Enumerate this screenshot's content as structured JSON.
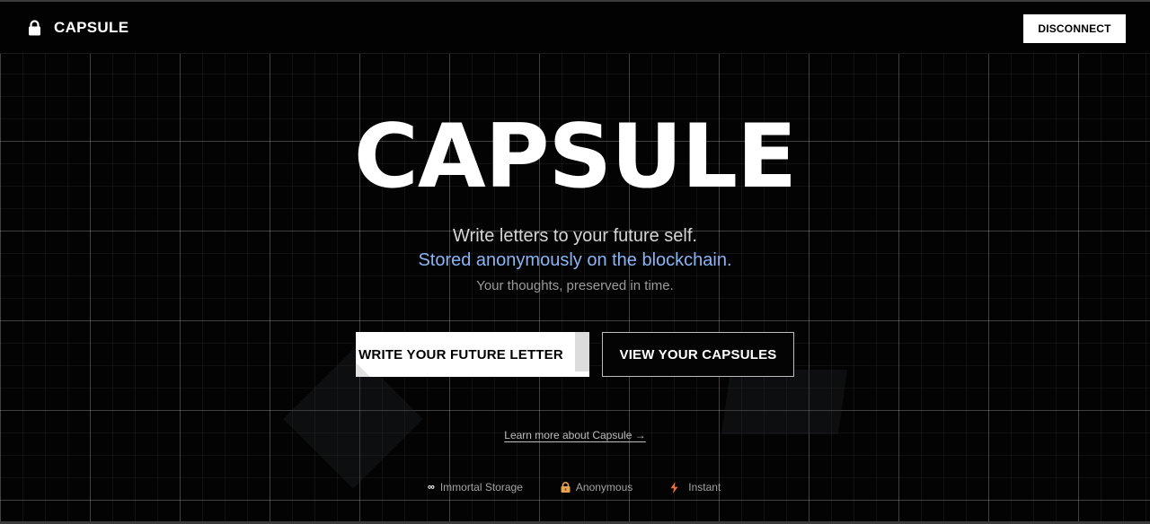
{
  "header": {
    "brand": "CAPSULE",
    "brand_icon": "lock-icon",
    "disconnect_label": "DISCONNECT"
  },
  "hero": {
    "title": "CAPSULE",
    "line1": "Write letters to your future self.",
    "line2": "Stored anonymously on the blockchain.",
    "line3": "Your thoughts, preserved in time."
  },
  "actions": {
    "write_label": "WRITE YOUR FUTURE LETTER",
    "view_label": "VIEW YOUR CAPSULES",
    "learn_more": "Learn more about Capsule →"
  },
  "features": [
    {
      "icon": "infinity-icon",
      "glyph": "∞",
      "label": "Immortal Storage"
    },
    {
      "icon": "lock-icon",
      "label": "Anonymous"
    },
    {
      "icon": "lightning-icon",
      "label": "Instant"
    }
  ],
  "colors": {
    "background": "#030303",
    "accent": "#8bb4f3",
    "button_primary": "#ffffff",
    "feature_lock": "#e9a24d",
    "feature_bolt": "#ee6f3a"
  }
}
